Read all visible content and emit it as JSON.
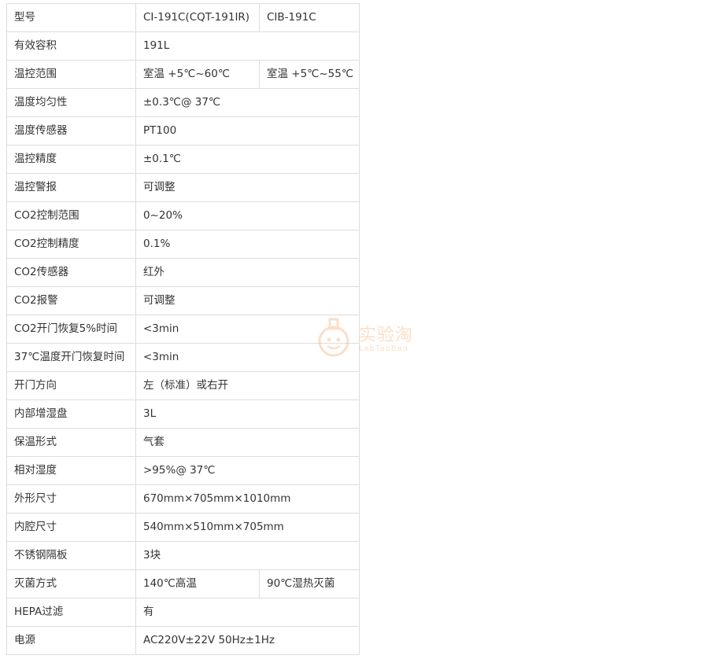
{
  "rows": [
    {
      "label": "型号",
      "values": [
        "CI-191C(CQT-191IR)",
        "CIB-191C"
      ]
    },
    {
      "label": "有效容积",
      "values": [
        "191L"
      ]
    },
    {
      "label": "温控范围",
      "values": [
        "室温 +5℃~60℃",
        "室温 +5℃~55℃"
      ]
    },
    {
      "label": "温度均匀性",
      "values": [
        "±0.3℃@ 37℃"
      ]
    },
    {
      "label": "温度传感器",
      "values": [
        "PT100"
      ]
    },
    {
      "label": "温控精度",
      "values": [
        "±0.1℃"
      ]
    },
    {
      "label": "温控警报",
      "values": [
        "可调整"
      ]
    },
    {
      "label": "CO2控制范围",
      "values": [
        "0~20%"
      ]
    },
    {
      "label": "CO2控制精度",
      "values": [
        "0.1%"
      ]
    },
    {
      "label": "CO2传感器",
      "values": [
        "红外"
      ]
    },
    {
      "label": "CO2报警",
      "values": [
        "可调整"
      ]
    },
    {
      "label": "CO2开门恢复5%时间",
      "values": [
        "<3min"
      ]
    },
    {
      "label": "37℃温度开门恢复时间",
      "values": [
        "<3min"
      ]
    },
    {
      "label": "开门方向",
      "values": [
        "左（标准）或右开"
      ]
    },
    {
      "label": "内部增湿盘",
      "values": [
        "3L"
      ]
    },
    {
      "label": "保温形式",
      "values": [
        "气套"
      ]
    },
    {
      "label": "相对湿度",
      "values": [
        ">95%@ 37℃"
      ]
    },
    {
      "label": "外形尺寸",
      "values": [
        "670mm×705mm×1010mm"
      ]
    },
    {
      "label": "内腔尺寸",
      "values": [
        "540mm×510mm×705mm"
      ]
    },
    {
      "label": "不锈钢隔板",
      "values": [
        "3块"
      ]
    },
    {
      "label": "灭菌方式",
      "values": [
        "140℃高温",
        "90℃湿热灭菌"
      ]
    },
    {
      "label": "HEPA过滤",
      "values": [
        "有"
      ]
    },
    {
      "label": "电源",
      "values": [
        "AC220V±22V 50Hz±1Hz"
      ]
    }
  ],
  "watermark": {
    "text": "实验淘",
    "sub": "LabTaoBao",
    "color": "#f4a460",
    "icon": "flask-mascot-icon"
  }
}
